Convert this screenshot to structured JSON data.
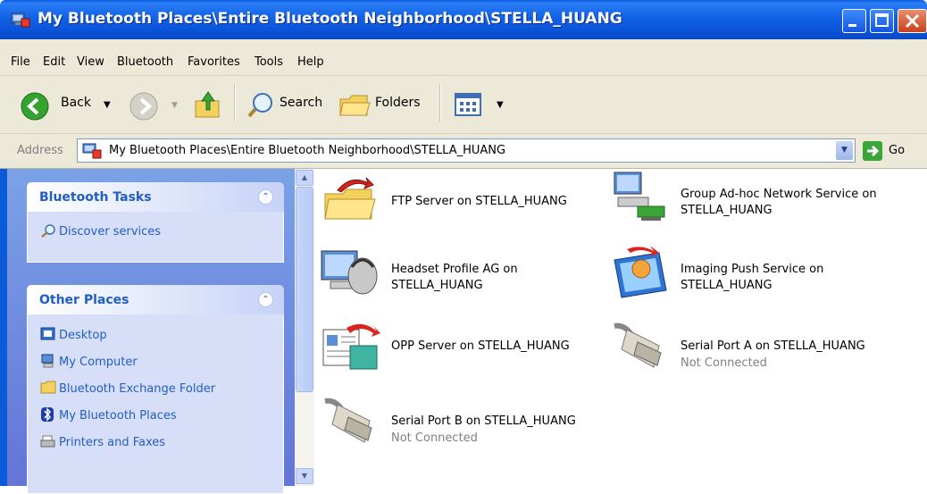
{
  "window": {
    "title": "My Bluetooth Places\\Entire Bluetooth Neighborhood\\STELLA_HUANG"
  },
  "menu": [
    "File",
    "Edit",
    "View",
    "Bluetooth",
    "Favorites",
    "Tools",
    "Help"
  ],
  "toolbar": {
    "back": "Back",
    "search": "Search",
    "folders": "Folders"
  },
  "address": {
    "label": "Address",
    "value": "My Bluetooth Places\\Entire Bluetooth Neighborhood\\STELLA_HUANG",
    "go": "Go"
  },
  "tasks": {
    "bluetooth_tasks": {
      "title": "Bluetooth Tasks",
      "items": [
        "Discover services"
      ]
    },
    "other_places": {
      "title": "Other Places",
      "items": [
        "Desktop",
        "My Computer",
        "Bluetooth Exchange Folder",
        "My Bluetooth Places",
        "Printers and Faxes"
      ]
    }
  },
  "services": [
    {
      "name": "FTP Server on STELLA_HUANG",
      "status": "",
      "icon": "ftp-server-icon"
    },
    {
      "name": "Group Ad-hoc Network Service on STELLA_HUANG",
      "status": "",
      "icon": "network-service-icon"
    },
    {
      "name": "Headset Profile AG on STELLA_HUANG",
      "status": "",
      "icon": "headset-icon"
    },
    {
      "name": "Imaging Push Service on STELLA_HUANG",
      "status": "",
      "icon": "imaging-icon"
    },
    {
      "name": "OPP Server on STELLA_HUANG",
      "status": "",
      "icon": "opp-server-icon"
    },
    {
      "name": "Serial Port A on STELLA_HUANG",
      "status": "Not Connected",
      "icon": "serial-port-icon"
    },
    {
      "name": "Serial Port B on STELLA_HUANG",
      "status": "Not Connected",
      "icon": "serial-port-icon"
    }
  ]
}
